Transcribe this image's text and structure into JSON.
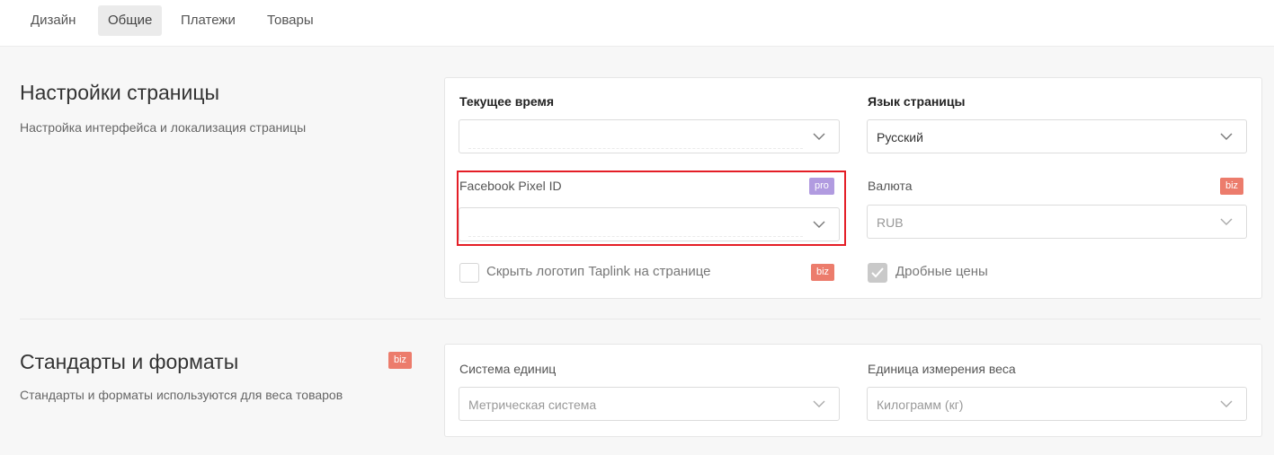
{
  "tabs": [
    {
      "label": "Дизайн",
      "active": false
    },
    {
      "label": "Общие",
      "active": true
    },
    {
      "label": "Платежи",
      "active": false
    },
    {
      "label": "Товары",
      "active": false
    }
  ],
  "page_settings": {
    "title": "Настройки страницы",
    "description": "Настройка интерфейса и локализация страницы",
    "current_time": {
      "label": "Текущее время",
      "value": ""
    },
    "page_language": {
      "label": "Язык страницы",
      "value": "Русский"
    },
    "facebook_pixel": {
      "label": "Facebook Pixel ID",
      "badge": "pro",
      "value": ""
    },
    "currency": {
      "label": "Валюта",
      "badge": "biz",
      "value": "RUB"
    },
    "hide_logo": {
      "label": "Скрыть логотип Taplink на странице",
      "badge": "biz",
      "checked": false
    },
    "fractional_prices": {
      "label": "Дробные цены",
      "checked": true
    }
  },
  "standards": {
    "title": "Стандарты и форматы",
    "badge": "biz",
    "description": "Стандарты и форматы используются для веса товаров",
    "unit_system": {
      "label": "Система единиц",
      "value": "Метрическая система"
    },
    "weight_unit": {
      "label": "Единица измерения веса",
      "value": "Килограмм (кг)"
    }
  },
  "colors": {
    "pro_badge": "#b19be0",
    "biz_badge": "#ec7c6c",
    "highlight": "#e41e26"
  },
  "icons": {
    "select_arrow": "chevron-down-icon",
    "checkbox_mark": "check-icon"
  }
}
